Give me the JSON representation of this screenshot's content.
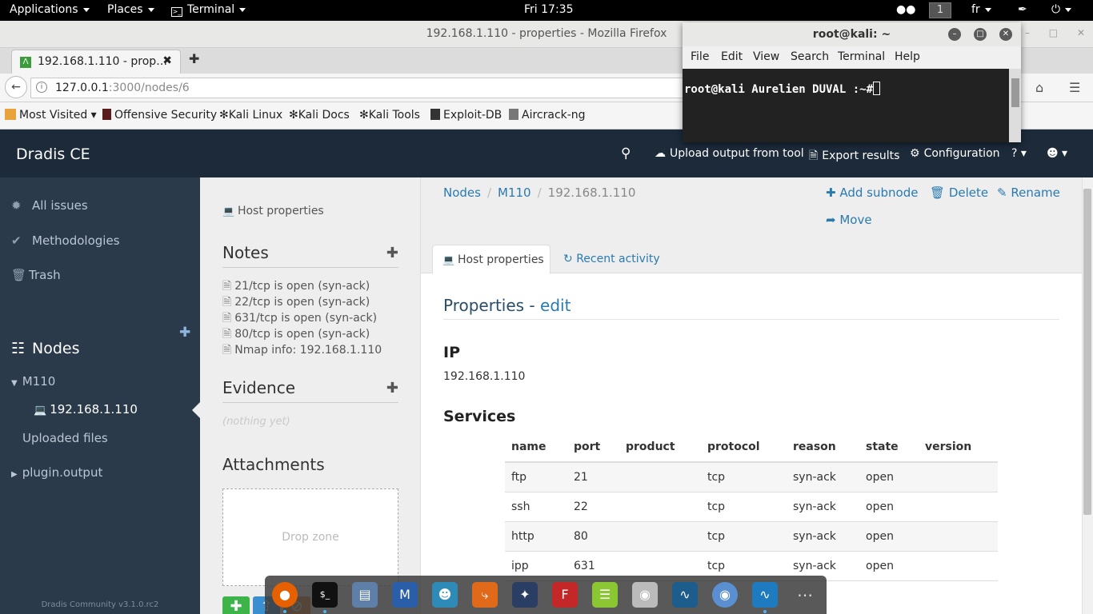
{
  "topbar": {
    "applications": "Applications",
    "places": "Places",
    "terminal": "Terminal",
    "clock": "Fri 17:35",
    "workspace": "1",
    "keyboard": "fr"
  },
  "firefox": {
    "window_title": "192.168.1.110 - properties - Mozilla Firefox",
    "tab_label": "192.168.1.110 - prop…",
    "url_host": "127.0.0.1",
    "url_rest": ":3000/nodes/6",
    "bookmarks": [
      "Most Visited",
      "Offensive Security",
      "Kali Linux",
      "Kali Docs",
      "Kali Tools",
      "Exploit-DB",
      "Aircrack-ng"
    ]
  },
  "dradis": {
    "brand": "Dradis CE",
    "nav": {
      "upload": "Upload output from tool",
      "export": "Export results",
      "config": "Configuration",
      "help": "?"
    },
    "sidebar": {
      "all_issues": "All issues",
      "methodologies": "Methodologies",
      "trash": "Trash",
      "nodes": "Nodes",
      "tree": {
        "root": "M110",
        "child": "192.168.1.110",
        "uploaded": "Uploaded files",
        "plugin": "plugin.output"
      },
      "footer": "Dradis Community v3.1.0.rc2"
    },
    "panel": {
      "host_properties": "Host properties",
      "notes_title": "Notes",
      "notes": [
        "21/tcp is open (syn-ack)",
        "22/tcp is open (syn-ack)",
        "631/tcp is open (syn-ack)",
        "80/tcp is open (syn-ack)",
        "Nmap info: 192.168.1.110"
      ],
      "evidence_title": "Evidence",
      "evidence_empty": "(nothing yet)",
      "attachments_title": "Attachments",
      "drop_zone": "Drop zone"
    },
    "main": {
      "breadcrumb": [
        "Nodes",
        "M110",
        "192.168.1.110"
      ],
      "actions": {
        "add_subnode": "Add subnode",
        "delete": "Delete",
        "rename": "Rename",
        "move": "Move"
      },
      "tabs": {
        "host_properties": "Host properties",
        "recent_activity": "Recent activity"
      },
      "properties_label": "Properties",
      "properties_dash": " - ",
      "edit_label": "edit",
      "ip_title": "IP",
      "ip_value": "192.168.1.110",
      "services_title": "Services",
      "services_columns": [
        "name",
        "port",
        "product",
        "protocol",
        "reason",
        "state",
        "version"
      ],
      "services_rows": [
        [
          "ftp",
          "21",
          "",
          "tcp",
          "syn-ack",
          "open",
          ""
        ],
        [
          "ssh",
          "22",
          "",
          "tcp",
          "syn-ack",
          "open",
          ""
        ],
        [
          "http",
          "80",
          "",
          "tcp",
          "syn-ack",
          "open",
          ""
        ],
        [
          "ipp",
          "631",
          "",
          "tcp",
          "syn-ack",
          "open",
          ""
        ]
      ]
    }
  },
  "terminal": {
    "title": "root@kali: ~",
    "menu": [
      "File",
      "Edit",
      "View",
      "Search",
      "Terminal",
      "Help"
    ],
    "prompt": "root@kali Aurelien DUVAL :~#"
  },
  "dock": {
    "apps": [
      "firefox-icon",
      "terminal-icon",
      "files-icon",
      "metasploit-icon",
      "maltego-icon",
      "burpsuite-icon",
      "armitage-icon",
      "faraday-icon",
      "leafpad-icon",
      "screenshot-icon",
      "wireshark-icon",
      "chromium-icon",
      "wireshark-alt-icon",
      "show-apps-icon"
    ]
  },
  "colors": {
    "dradis_nav": "#1c2a3a",
    "sidebar": "#2b3a4b",
    "link": "#2a7ab0",
    "heading": "#2a4d69"
  }
}
